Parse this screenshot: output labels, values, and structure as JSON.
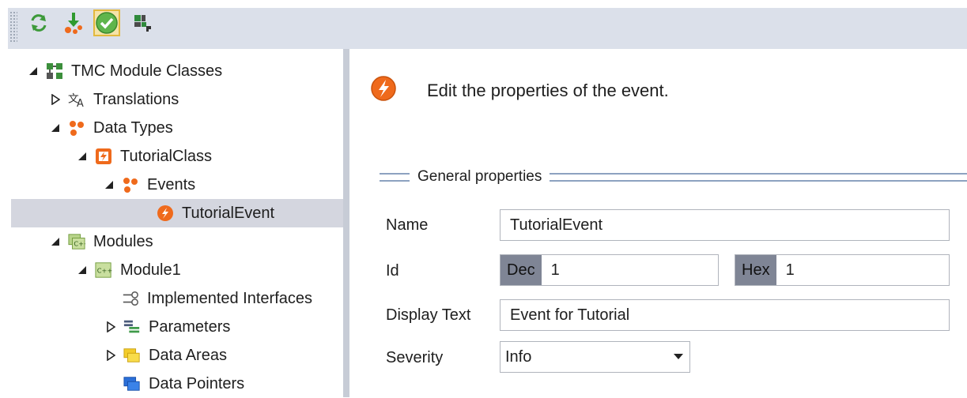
{
  "toolbar": {
    "buttons": [
      {
        "name": "refresh-icon",
        "active": false
      },
      {
        "name": "import-icon",
        "active": false
      },
      {
        "name": "check-icon",
        "active": true
      },
      {
        "name": "settings-plugin-icon",
        "active": false
      }
    ]
  },
  "tree": {
    "items": [
      {
        "label": "TMC Module Classes",
        "expander": "expanded",
        "icon": "module-classes-icon"
      },
      {
        "label": "Translations",
        "expander": "collapsed",
        "icon": "translations-icon"
      },
      {
        "label": "Data Types",
        "expander": "expanded",
        "icon": "data-types-icon"
      },
      {
        "label": "TutorialClass",
        "expander": "expanded",
        "icon": "event-class-icon"
      },
      {
        "label": "Events",
        "expander": "expanded",
        "icon": "events-icon"
      },
      {
        "label": "TutorialEvent",
        "expander": "none",
        "icon": "event-icon",
        "selected": true
      },
      {
        "label": "Modules",
        "expander": "expanded",
        "icon": "modules-icon"
      },
      {
        "label": "Module1",
        "expander": "expanded",
        "icon": "module-icon"
      },
      {
        "label": "Implemented Interfaces",
        "expander": "none",
        "icon": "interfaces-icon"
      },
      {
        "label": "Parameters",
        "expander": "collapsed",
        "icon": "parameters-icon"
      },
      {
        "label": "Data Areas",
        "expander": "collapsed",
        "icon": "data-areas-icon"
      },
      {
        "label": "Data Pointers",
        "expander": "none",
        "icon": "data-pointers-icon"
      }
    ]
  },
  "editor": {
    "header": "Edit the properties of the event.",
    "group_title": "General properties",
    "name_label": "Name",
    "name_value": "TutorialEvent",
    "id_label": "Id",
    "dec_prefix": "Dec",
    "dec_value": "1",
    "hex_prefix": "Hex",
    "hex_value": "1",
    "display_text_label": "Display Text",
    "display_text_value": "Event for Tutorial",
    "severity_label": "Severity",
    "severity_value": "Info"
  },
  "colors": {
    "toolbar_bg": "#dbe0ea",
    "selection_bg": "#d4d6df",
    "event_orange": "#ef6a1c",
    "prefix_bg": "#7f8595"
  }
}
